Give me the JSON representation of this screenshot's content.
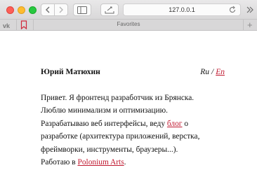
{
  "browser": {
    "url": "127.0.0.1",
    "favorites_title": "Favorites",
    "favorites_add": "+"
  },
  "profile": {
    "name": "Юрий Матюхин",
    "lang_ru": "Ru",
    "lang_sep": "/",
    "lang_en": "En"
  },
  "bio": {
    "line1": "Привет. Я фронтенд разработчик из Брянска.",
    "line2": "Люблю минимализм и оптимизацию.",
    "line3_pre": "Разрабатываю веб интерфейсы, веду ",
    "blog_link": "блог",
    "line3_post": " о",
    "line4": "разработке (архитектура приложений, верстка,",
    "line5": "фреймворки, инструменты, браузеры...).",
    "line6_pre": "Работаю в ",
    "company_link": "Polonium Arts",
    "line6_post": "."
  },
  "colors": {
    "link": "#c0182f"
  }
}
